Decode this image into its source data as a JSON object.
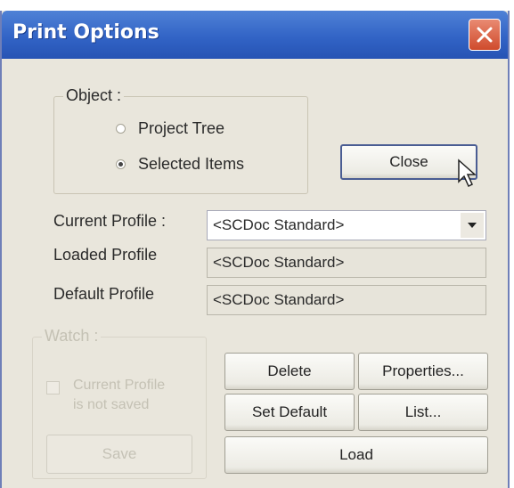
{
  "window": {
    "title": "Print Options"
  },
  "object_group": {
    "label": "Object :",
    "options": [
      {
        "label": "Project Tree",
        "selected": false
      },
      {
        "label": "Selected Items",
        "selected": true
      }
    ]
  },
  "buttons": {
    "close": "Close",
    "delete": "Delete",
    "properties": "Properties...",
    "set_default": "Set Default",
    "list": "List...",
    "load": "Load",
    "save": "Save"
  },
  "profiles": {
    "current_label": "Current Profile :",
    "current_value": "<SCDoc Standard>",
    "loaded_label": "Loaded Profile",
    "loaded_value": "<SCDoc Standard>",
    "default_label": "Default Profile",
    "default_value": "<SCDoc Standard>"
  },
  "watch_group": {
    "label": "Watch :",
    "checkbox_line1": "Current Profile",
    "checkbox_line2": "is not saved"
  },
  "icons": {
    "window_close": "close-icon",
    "dropdown": "chevron-down-icon",
    "pointer": "mouse-pointer-icon"
  },
  "colors": {
    "titlebar": "#3264c6",
    "close_button": "#d4583a",
    "dialog_bg": "#e9e6dc"
  }
}
